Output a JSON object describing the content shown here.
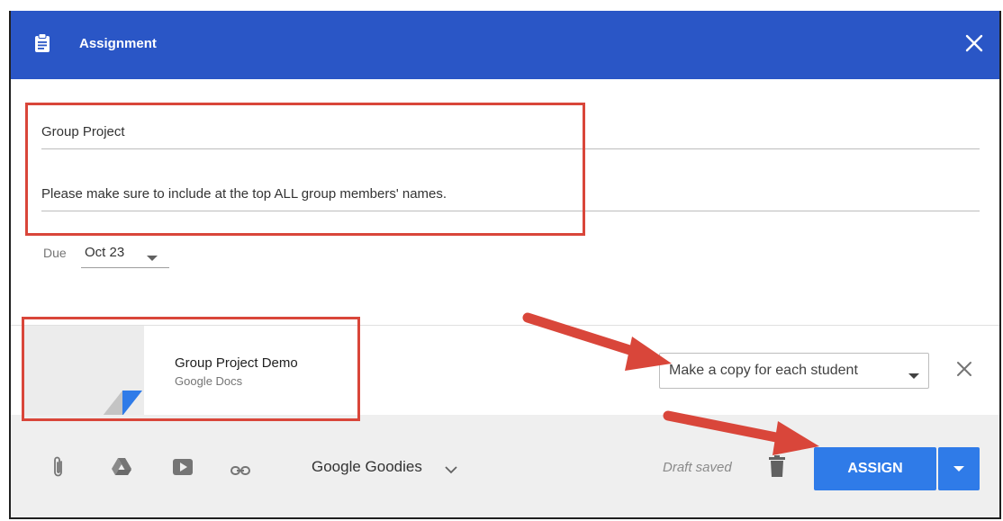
{
  "dialog": {
    "title": "Assignment"
  },
  "form": {
    "title_value": "Group Project",
    "description_value": "Please make sure to include at the top ALL group members' names.",
    "due_label": "Due",
    "due_value": "Oct 23"
  },
  "attachment": {
    "name": "Group Project Demo",
    "type": "Google Docs",
    "share_option": "Make a copy for each student"
  },
  "footer": {
    "goodies_label": "Google Goodies",
    "status": "Draft saved",
    "assign_label": "ASSIGN"
  },
  "colors": {
    "header": "#2a56c6",
    "assign_button": "#2f7be8",
    "annotation": "#d9463a"
  },
  "icons": [
    "clipboard-icon",
    "close-icon",
    "caret-down-icon",
    "docs-corner-icon",
    "paperclip-icon",
    "drive-icon",
    "youtube-icon",
    "link-icon",
    "chevron-down-icon",
    "trash-icon",
    "arrow-icon"
  ]
}
